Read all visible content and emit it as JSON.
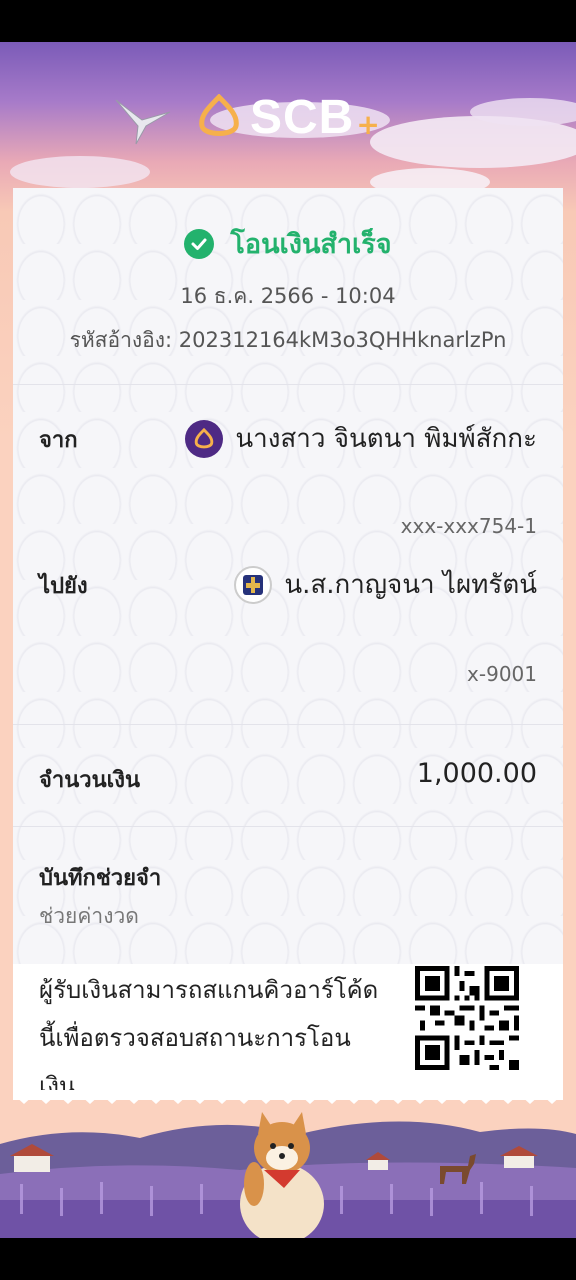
{
  "brand": {
    "name": "SCB",
    "plus": "+"
  },
  "receipt": {
    "status": "โอนเงินสำเร็จ",
    "datetime": "16 ธ.ค. 2566 - 10:04",
    "reference": "รหัสอ้างอิง: 202312164kM3o3QHHknarlzPn",
    "from": {
      "label": "จาก",
      "name": "นางสาว จินตนา พิมพ์สักกะ",
      "account": "xxx-xxx754-1",
      "bank_icon": "scb-bank-icon"
    },
    "to": {
      "label": "ไปยัง",
      "name": "น.ส.กาญจนา ไผทรัตน์",
      "account": "x-9001",
      "bank_icon": "gsb-bank-icon"
    },
    "amount": {
      "label": "จำนวนเงิน",
      "value": "1,000.00"
    },
    "memo": {
      "label": "บันทึกช่วยจำ",
      "value": "ช่วยค่างวด"
    },
    "qr_note": "ผู้รับเงินสามารถสแกนคิวอาร์โค้ดนี้เพื่อตรวจสอบสถานะการโอนเงิน"
  },
  "colors": {
    "success": "#23b26d",
    "brand_purple": "#4e2a84",
    "brand_gold": "#f6b04b"
  }
}
